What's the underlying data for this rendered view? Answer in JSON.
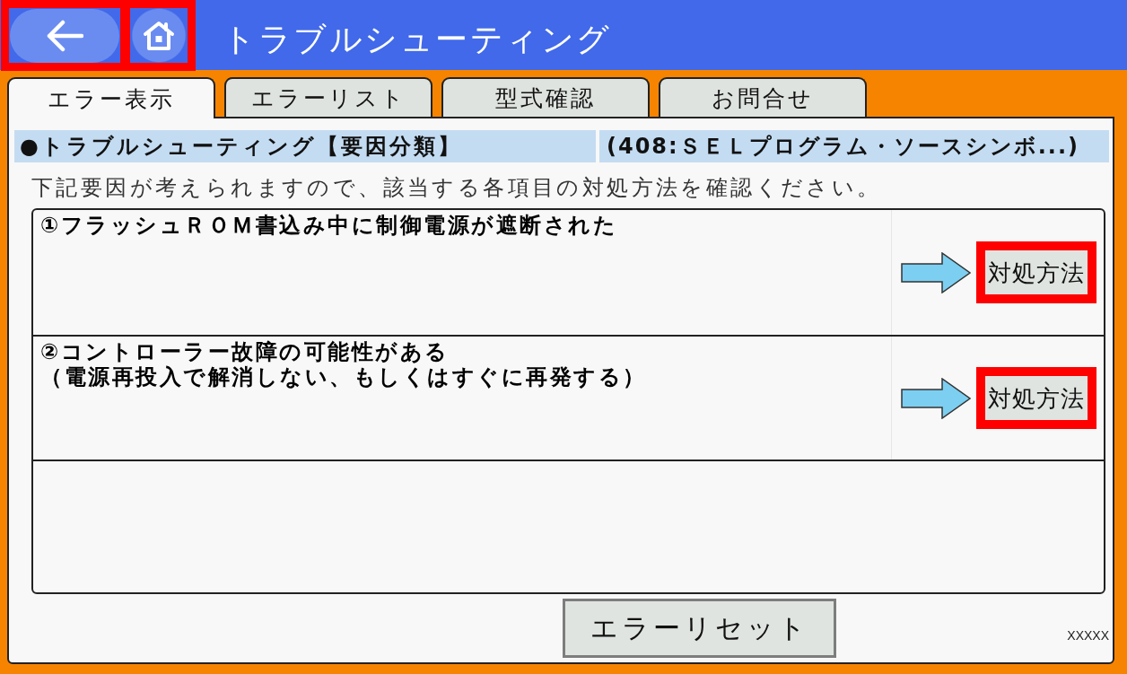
{
  "header": {
    "nav_buttons": [
      {
        "kind": "back",
        "highlighted": true
      },
      {
        "kind": "home",
        "highlighted": true
      }
    ],
    "title": "トラブルシューティング"
  },
  "tabs": [
    {
      "label": "エラー表示",
      "selected": true
    },
    {
      "label": "エラーリスト",
      "selected": false
    },
    {
      "label": "型式確認",
      "selected": false
    },
    {
      "label": "お問合せ",
      "selected": false
    }
  ],
  "panel": {
    "heading": "●トラブルシューティング【要因分類】",
    "error_name": "(408:ＳＥＬプログラム・ソースシンボ...)",
    "instruction": "下記要因が考えられますので、該当する各項目の対処方法を確認ください。",
    "causes": [
      {
        "lines": [
          "①フラッシュＲＯＭ書込み中に制御電源が遮断された"
        ],
        "action": {
          "label": "対処方法",
          "highlighted": true
        }
      },
      {
        "lines": [
          "②コントローラー故障の可能性がある",
          "（電源再投入で解消しない、もしくはすぐに再発する）"
        ],
        "action": {
          "label": "対処方法",
          "highlighted": true
        }
      }
    ],
    "reset_button": {
      "label": "エラーリセット"
    },
    "footer_code": "XXXXX"
  }
}
